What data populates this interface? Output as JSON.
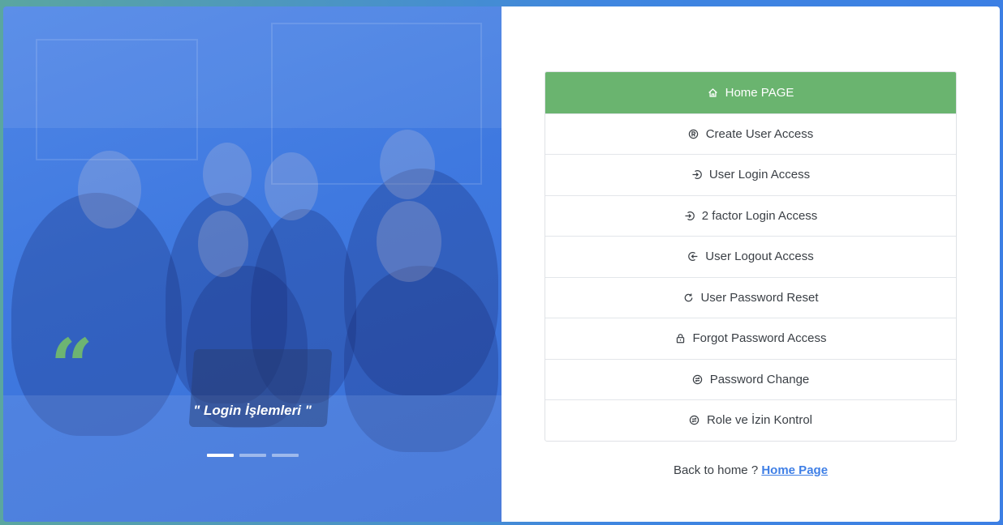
{
  "hero": {
    "quote_mark": "“",
    "caption": "\" Login İşlemleri \"",
    "carousel": {
      "slides": 3,
      "active_index": 0
    }
  },
  "menu": {
    "items": [
      {
        "label": "Home PAGE",
        "icon": "home-icon",
        "active": true
      },
      {
        "label": "Create User Access",
        "icon": "registered-icon",
        "active": false
      },
      {
        "label": "User Login Access",
        "icon": "login-icon",
        "active": false
      },
      {
        "label": "2 factor Login Access",
        "icon": "login-icon",
        "active": false
      },
      {
        "label": "User Logout Access",
        "icon": "logout-icon",
        "active": false
      },
      {
        "label": "User Password Reset",
        "icon": "refresh-icon",
        "active": false
      },
      {
        "label": "Forgot Password Access",
        "icon": "lock-icon",
        "active": false
      },
      {
        "label": "Password Change",
        "icon": "exchange-icon",
        "active": false
      },
      {
        "label": "Role ve İzin Kontrol",
        "icon": "exchange-icon",
        "active": false
      }
    ]
  },
  "footer": {
    "back_text": "Back to home ?",
    "home_link": "Home Page"
  },
  "colors": {
    "accent_green": "#6ab46f",
    "hero_blue": "#3f79e0",
    "link_blue": "#3f7fe6"
  }
}
